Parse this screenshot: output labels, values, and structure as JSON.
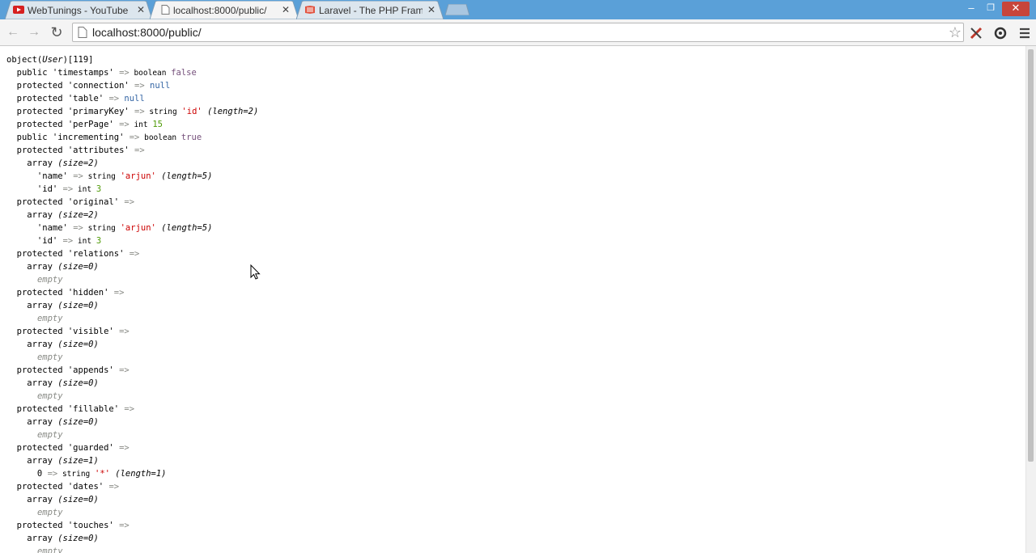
{
  "tabs": [
    {
      "title": "WebTunings - YouTube",
      "icon": "youtube-icon",
      "active": false
    },
    {
      "title": "localhost:8000/public/",
      "icon": "page-icon",
      "active": true
    },
    {
      "title": "Laravel - The PHP Framework",
      "icon": "laravel-icon",
      "active": false
    }
  ],
  "window_controls": {
    "minimize": "‒",
    "restore": "❐",
    "close": "✕"
  },
  "toolbar": {
    "back": "←",
    "forward": "→",
    "reload": "↻",
    "url": "localhost:8000/public/",
    "star": "☆"
  },
  "dump": [
    [
      [
        "object(",
        "t"
      ],
      [
        "User",
        "i"
      ],
      [
        ")[119]",
        "t"
      ]
    ],
    [
      [
        "  public 'timestamps' ",
        "t"
      ],
      [
        "=>",
        "op"
      ],
      [
        " boolean ",
        "type"
      ],
      [
        "false",
        "b"
      ]
    ],
    [
      [
        "  protected 'connection' ",
        "t"
      ],
      [
        "=>",
        "op"
      ],
      [
        " null",
        "nu"
      ]
    ],
    [
      [
        "  protected 'table' ",
        "t"
      ],
      [
        "=>",
        "op"
      ],
      [
        " null",
        "nu"
      ]
    ],
    [
      [
        "  protected 'primaryKey' ",
        "t"
      ],
      [
        "=>",
        "op"
      ],
      [
        " string ",
        "type"
      ],
      [
        "'id'",
        "s"
      ],
      [
        " (length=2)",
        "i"
      ]
    ],
    [
      [
        "  protected 'perPage' ",
        "t"
      ],
      [
        "=>",
        "op"
      ],
      [
        " int ",
        "type"
      ],
      [
        "15",
        "n"
      ]
    ],
    [
      [
        "  public 'incrementing' ",
        "t"
      ],
      [
        "=>",
        "op"
      ],
      [
        " boolean ",
        "type"
      ],
      [
        "true",
        "b"
      ]
    ],
    [
      [
        "  protected 'attributes' ",
        "t"
      ],
      [
        "=>",
        "op"
      ]
    ],
    [
      [
        "    array ",
        "t"
      ],
      [
        "(size=2)",
        "i"
      ]
    ],
    [
      [
        "      'name' ",
        "t"
      ],
      [
        "=>",
        "op"
      ],
      [
        " string ",
        "type"
      ],
      [
        "'arjun'",
        "s"
      ],
      [
        " (length=5)",
        "i"
      ]
    ],
    [
      [
        "      'id' ",
        "t"
      ],
      [
        "=>",
        "op"
      ],
      [
        " int ",
        "type"
      ],
      [
        "3",
        "n"
      ]
    ],
    [
      [
        "  protected 'original' ",
        "t"
      ],
      [
        "=>",
        "op"
      ]
    ],
    [
      [
        "    array ",
        "t"
      ],
      [
        "(size=2)",
        "i"
      ]
    ],
    [
      [
        "      'name' ",
        "t"
      ],
      [
        "=>",
        "op"
      ],
      [
        " string ",
        "type"
      ],
      [
        "'arjun'",
        "s"
      ],
      [
        " (length=5)",
        "i"
      ]
    ],
    [
      [
        "      'id' ",
        "t"
      ],
      [
        "=>",
        "op"
      ],
      [
        " int ",
        "type"
      ],
      [
        "3",
        "n"
      ]
    ],
    [
      [
        "  protected 'relations' ",
        "t"
      ],
      [
        "=>",
        "op"
      ]
    ],
    [
      [
        "    array ",
        "t"
      ],
      [
        "(size=0)",
        "i"
      ]
    ],
    [
      [
        "      ",
        "t"
      ],
      [
        "empty",
        "e"
      ]
    ],
    [
      [
        "  protected 'hidden' ",
        "t"
      ],
      [
        "=>",
        "op"
      ]
    ],
    [
      [
        "    array ",
        "t"
      ],
      [
        "(size=0)",
        "i"
      ]
    ],
    [
      [
        "      ",
        "t"
      ],
      [
        "empty",
        "e"
      ]
    ],
    [
      [
        "  protected 'visible' ",
        "t"
      ],
      [
        "=>",
        "op"
      ]
    ],
    [
      [
        "    array ",
        "t"
      ],
      [
        "(size=0)",
        "i"
      ]
    ],
    [
      [
        "      ",
        "t"
      ],
      [
        "empty",
        "e"
      ]
    ],
    [
      [
        "  protected 'appends' ",
        "t"
      ],
      [
        "=>",
        "op"
      ]
    ],
    [
      [
        "    array ",
        "t"
      ],
      [
        "(size=0)",
        "i"
      ]
    ],
    [
      [
        "      ",
        "t"
      ],
      [
        "empty",
        "e"
      ]
    ],
    [
      [
        "  protected 'fillable' ",
        "t"
      ],
      [
        "=>",
        "op"
      ]
    ],
    [
      [
        "    array ",
        "t"
      ],
      [
        "(size=0)",
        "i"
      ]
    ],
    [
      [
        "      ",
        "t"
      ],
      [
        "empty",
        "e"
      ]
    ],
    [
      [
        "  protected 'guarded' ",
        "t"
      ],
      [
        "=>",
        "op"
      ]
    ],
    [
      [
        "    array ",
        "t"
      ],
      [
        "(size=1)",
        "i"
      ]
    ],
    [
      [
        "      0 ",
        "t"
      ],
      [
        "=>",
        "op"
      ],
      [
        " string ",
        "type"
      ],
      [
        "'*'",
        "s"
      ],
      [
        " (length=1)",
        "i"
      ]
    ],
    [
      [
        "  protected 'dates' ",
        "t"
      ],
      [
        "=>",
        "op"
      ]
    ],
    [
      [
        "    array ",
        "t"
      ],
      [
        "(size=0)",
        "i"
      ]
    ],
    [
      [
        "      ",
        "t"
      ],
      [
        "empty",
        "e"
      ]
    ],
    [
      [
        "  protected 'touches' ",
        "t"
      ],
      [
        "=>",
        "op"
      ]
    ],
    [
      [
        "    array ",
        "t"
      ],
      [
        "(size=0)",
        "i"
      ]
    ],
    [
      [
        "      ",
        "t"
      ],
      [
        "empty",
        "e"
      ]
    ]
  ],
  "colors": {
    "titlebar": "#5aa0d8",
    "string": "#cc0000",
    "int": "#4e9a06",
    "null": "#3465a4",
    "bool": "#75507b"
  }
}
